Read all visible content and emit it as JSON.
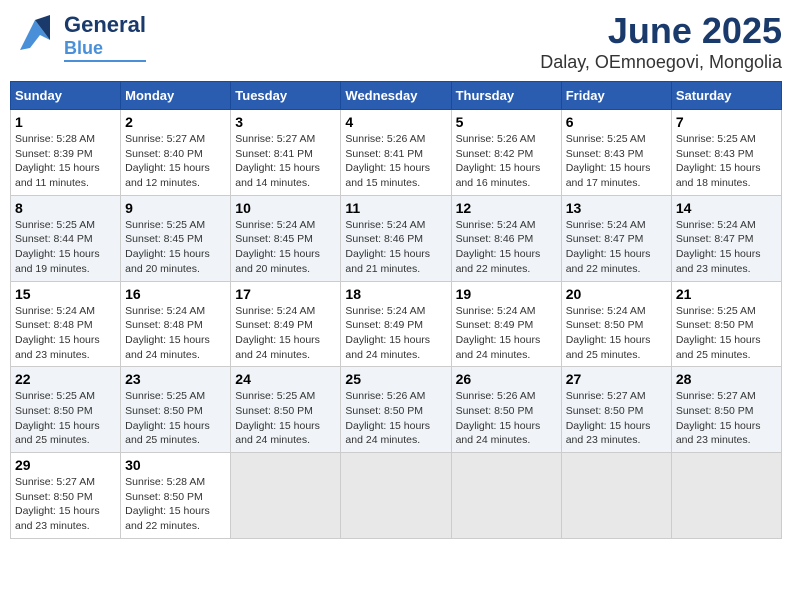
{
  "header": {
    "logo_line1": "General",
    "logo_line2": "Blue",
    "title": "June 2025",
    "subtitle": "Dalay, OEmnoegovi, Mongolia"
  },
  "calendar": {
    "days_of_week": [
      "Sunday",
      "Monday",
      "Tuesday",
      "Wednesday",
      "Thursday",
      "Friday",
      "Saturday"
    ],
    "weeks": [
      [
        {
          "num": "",
          "info": "",
          "empty": true
        },
        {
          "num": "2",
          "info": "Sunrise: 5:27 AM\nSunset: 8:40 PM\nDaylight: 15 hours\nand 12 minutes."
        },
        {
          "num": "3",
          "info": "Sunrise: 5:27 AM\nSunset: 8:41 PM\nDaylight: 15 hours\nand 14 minutes."
        },
        {
          "num": "4",
          "info": "Sunrise: 5:26 AM\nSunset: 8:41 PM\nDaylight: 15 hours\nand 15 minutes."
        },
        {
          "num": "5",
          "info": "Sunrise: 5:26 AM\nSunset: 8:42 PM\nDaylight: 15 hours\nand 16 minutes."
        },
        {
          "num": "6",
          "info": "Sunrise: 5:25 AM\nSunset: 8:43 PM\nDaylight: 15 hours\nand 17 minutes."
        },
        {
          "num": "7",
          "info": "Sunrise: 5:25 AM\nSunset: 8:43 PM\nDaylight: 15 hours\nand 18 minutes."
        }
      ],
      [
        {
          "num": "1",
          "info": "Sunrise: 5:28 AM\nSunset: 8:39 PM\nDaylight: 15 hours\nand 11 minutes."
        },
        {
          "num": "",
          "info": "",
          "empty": true
        },
        {
          "num": "",
          "info": "",
          "empty": true
        },
        {
          "num": "",
          "info": "",
          "empty": true
        },
        {
          "num": "",
          "info": "",
          "empty": true
        },
        {
          "num": "",
          "info": "",
          "empty": true
        },
        {
          "num": "",
          "info": "",
          "empty": true
        }
      ],
      [
        {
          "num": "8",
          "info": "Sunrise: 5:25 AM\nSunset: 8:44 PM\nDaylight: 15 hours\nand 19 minutes."
        },
        {
          "num": "9",
          "info": "Sunrise: 5:25 AM\nSunset: 8:45 PM\nDaylight: 15 hours\nand 20 minutes."
        },
        {
          "num": "10",
          "info": "Sunrise: 5:24 AM\nSunset: 8:45 PM\nDaylight: 15 hours\nand 20 minutes."
        },
        {
          "num": "11",
          "info": "Sunrise: 5:24 AM\nSunset: 8:46 PM\nDaylight: 15 hours\nand 21 minutes."
        },
        {
          "num": "12",
          "info": "Sunrise: 5:24 AM\nSunset: 8:46 PM\nDaylight: 15 hours\nand 22 minutes."
        },
        {
          "num": "13",
          "info": "Sunrise: 5:24 AM\nSunset: 8:47 PM\nDaylight: 15 hours\nand 22 minutes."
        },
        {
          "num": "14",
          "info": "Sunrise: 5:24 AM\nSunset: 8:47 PM\nDaylight: 15 hours\nand 23 minutes."
        }
      ],
      [
        {
          "num": "15",
          "info": "Sunrise: 5:24 AM\nSunset: 8:48 PM\nDaylight: 15 hours\nand 23 minutes."
        },
        {
          "num": "16",
          "info": "Sunrise: 5:24 AM\nSunset: 8:48 PM\nDaylight: 15 hours\nand 24 minutes."
        },
        {
          "num": "17",
          "info": "Sunrise: 5:24 AM\nSunset: 8:49 PM\nDaylight: 15 hours\nand 24 minutes."
        },
        {
          "num": "18",
          "info": "Sunrise: 5:24 AM\nSunset: 8:49 PM\nDaylight: 15 hours\nand 24 minutes."
        },
        {
          "num": "19",
          "info": "Sunrise: 5:24 AM\nSunset: 8:49 PM\nDaylight: 15 hours\nand 24 minutes."
        },
        {
          "num": "20",
          "info": "Sunrise: 5:24 AM\nSunset: 8:50 PM\nDaylight: 15 hours\nand 25 minutes."
        },
        {
          "num": "21",
          "info": "Sunrise: 5:25 AM\nSunset: 8:50 PM\nDaylight: 15 hours\nand 25 minutes."
        }
      ],
      [
        {
          "num": "22",
          "info": "Sunrise: 5:25 AM\nSunset: 8:50 PM\nDaylight: 15 hours\nand 25 minutes."
        },
        {
          "num": "23",
          "info": "Sunrise: 5:25 AM\nSunset: 8:50 PM\nDaylight: 15 hours\nand 25 minutes."
        },
        {
          "num": "24",
          "info": "Sunrise: 5:25 AM\nSunset: 8:50 PM\nDaylight: 15 hours\nand 24 minutes."
        },
        {
          "num": "25",
          "info": "Sunrise: 5:26 AM\nSunset: 8:50 PM\nDaylight: 15 hours\nand 24 minutes."
        },
        {
          "num": "26",
          "info": "Sunrise: 5:26 AM\nSunset: 8:50 PM\nDaylight: 15 hours\nand 24 minutes."
        },
        {
          "num": "27",
          "info": "Sunrise: 5:27 AM\nSunset: 8:50 PM\nDaylight: 15 hours\nand 23 minutes."
        },
        {
          "num": "28",
          "info": "Sunrise: 5:27 AM\nSunset: 8:50 PM\nDaylight: 15 hours\nand 23 minutes."
        }
      ],
      [
        {
          "num": "29",
          "info": "Sunrise: 5:27 AM\nSunset: 8:50 PM\nDaylight: 15 hours\nand 23 minutes."
        },
        {
          "num": "30",
          "info": "Sunrise: 5:28 AM\nSunset: 8:50 PM\nDaylight: 15 hours\nand 22 minutes."
        },
        {
          "num": "",
          "info": "",
          "empty": true
        },
        {
          "num": "",
          "info": "",
          "empty": true
        },
        {
          "num": "",
          "info": "",
          "empty": true
        },
        {
          "num": "",
          "info": "",
          "empty": true
        },
        {
          "num": "",
          "info": "",
          "empty": true
        }
      ]
    ]
  }
}
